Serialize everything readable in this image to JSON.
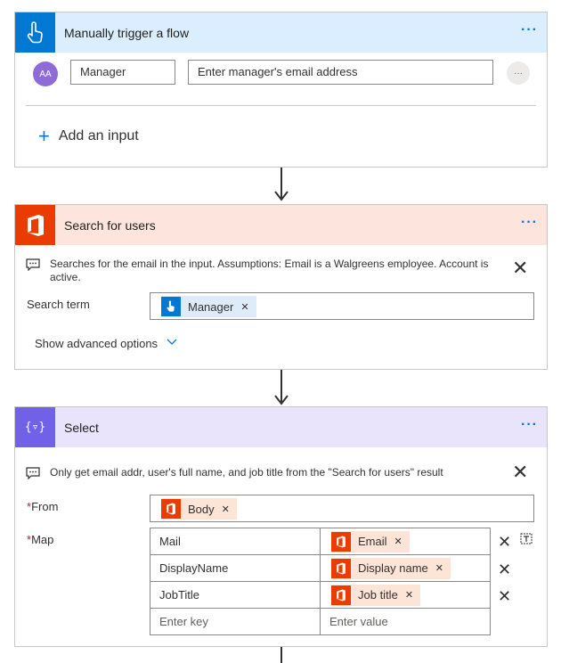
{
  "trigger": {
    "title": "Manually trigger a flow",
    "avatar_text": "AA",
    "input_name": "Manager",
    "input_description": "Enter manager's email address",
    "add_input_label": "Add an input",
    "more_label": "···"
  },
  "search": {
    "title": "Search for users",
    "comment": "Searches for the email in the input. Assumptions: Email is a Walgreens employee. Account is active.",
    "search_term_label": "Search term",
    "search_term_token": "Manager",
    "advanced_label": "Show advanced options"
  },
  "select": {
    "title": "Select",
    "comment": "Only get email addr, user's full name, and job title from the \"Search for users\" result",
    "from_label": "From",
    "from_token": "Body",
    "map_label": "Map",
    "required_mark": "*",
    "rows": [
      {
        "key": "Mail",
        "value": "Email"
      },
      {
        "key": "DisplayName",
        "value": "Display name"
      },
      {
        "key": "JobTitle",
        "value": "Job title"
      }
    ],
    "key_placeholder": "Enter key",
    "value_placeholder": "Enter value"
  },
  "colors": {
    "trigger_header": "#dbeeff",
    "trigger_icon": "#0078d4",
    "office_header": "#fde4dd",
    "office_icon": "#eb3c00",
    "select_header": "#e9e4fb",
    "select_icon": "#7160e8",
    "accent": "#0078d4"
  }
}
